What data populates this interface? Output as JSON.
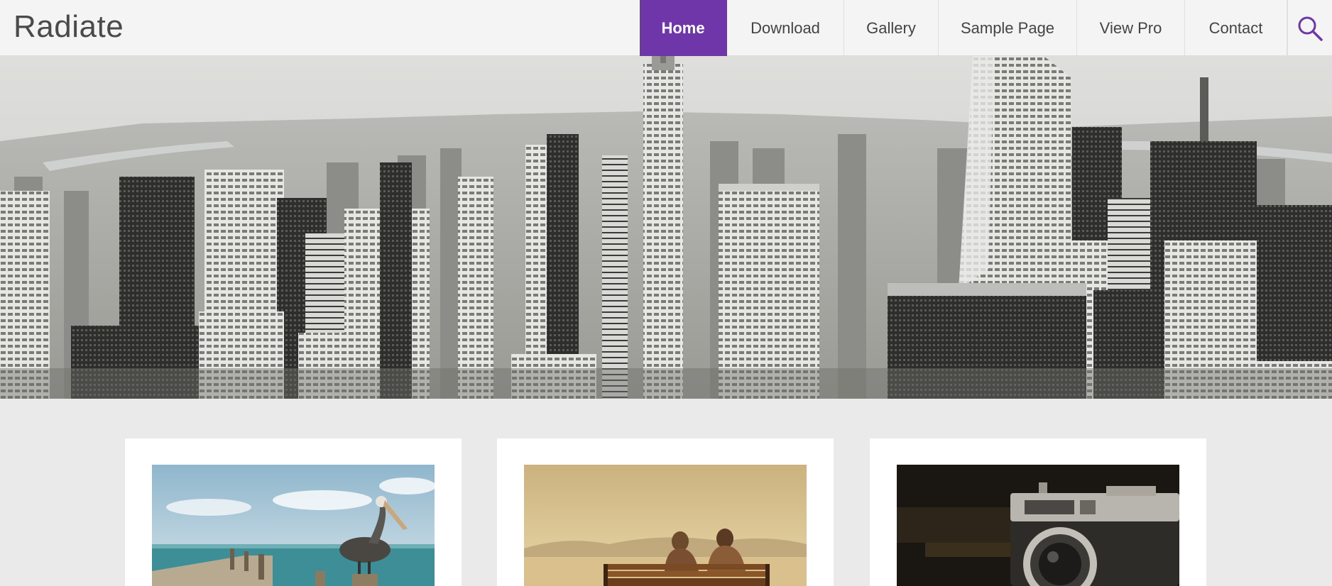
{
  "site": {
    "title": "Radiate"
  },
  "nav": {
    "items": [
      {
        "label": "Home",
        "active": true
      },
      {
        "label": "Download",
        "active": false
      },
      {
        "label": "Gallery",
        "active": false
      },
      {
        "label": "Sample Page",
        "active": false
      },
      {
        "label": "View Pro",
        "active": false
      },
      {
        "label": "Contact",
        "active": false
      }
    ],
    "search_icon": "search-icon"
  },
  "colors": {
    "accent": "#6e36a8",
    "header_bg": "#f4f4f4",
    "page_bg": "#eaeaea",
    "card_bg": "#ffffff"
  },
  "hero": {
    "image": "city-skyline-photo"
  },
  "posts": [
    {
      "image": "pelican-pier-photo"
    },
    {
      "image": "couple-on-bench-photo"
    },
    {
      "image": "vintage-camera-photo"
    }
  ]
}
